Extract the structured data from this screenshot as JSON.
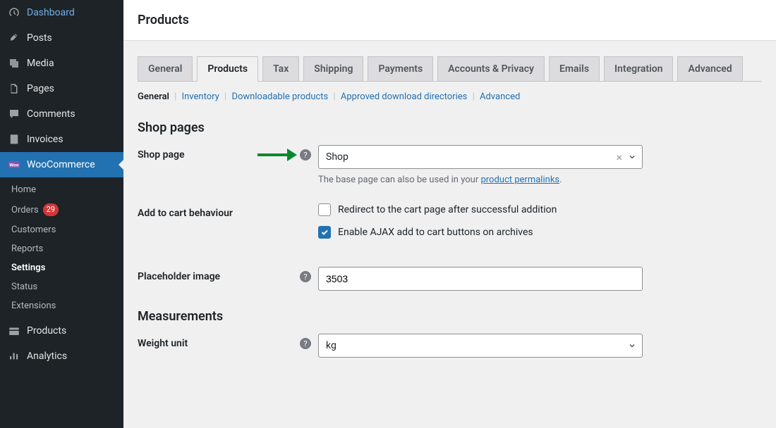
{
  "sidebar": {
    "items": [
      {
        "label": "Dashboard"
      },
      {
        "label": "Posts"
      },
      {
        "label": "Media"
      },
      {
        "label": "Pages"
      },
      {
        "label": "Comments"
      },
      {
        "label": "Invoices"
      },
      {
        "label": "WooCommerce"
      },
      {
        "label": "Products"
      },
      {
        "label": "Analytics"
      }
    ],
    "sub": {
      "home": "Home",
      "orders": "Orders",
      "orders_badge": "29",
      "customers": "Customers",
      "reports": "Reports",
      "settings": "Settings",
      "status": "Status",
      "extensions": "Extensions"
    }
  },
  "page_title": "Products",
  "tabs": [
    "General",
    "Products",
    "Tax",
    "Shipping",
    "Payments",
    "Accounts & Privacy",
    "Emails",
    "Integration",
    "Advanced"
  ],
  "active_tab": 1,
  "subnav": [
    "General",
    "Inventory",
    "Downloadable products",
    "Approved download directories",
    "Advanced"
  ],
  "active_subnav": 0,
  "sections": {
    "shop_pages_heading": "Shop pages",
    "measurements_heading": "Measurements"
  },
  "fields": {
    "shop_page": {
      "label": "Shop page",
      "value": "Shop",
      "desc_prefix": "The base page can also be used in your ",
      "desc_link": "product permalinks",
      "desc_suffix": "."
    },
    "add_to_cart": {
      "label": "Add to cart behaviour",
      "opt_redirect": "Redirect to the cart page after successful addition",
      "opt_ajax": "Enable AJAX add to cart buttons on archives"
    },
    "placeholder_image": {
      "label": "Placeholder image",
      "value": "3503"
    },
    "weight_unit": {
      "label": "Weight unit",
      "value": "kg"
    }
  }
}
